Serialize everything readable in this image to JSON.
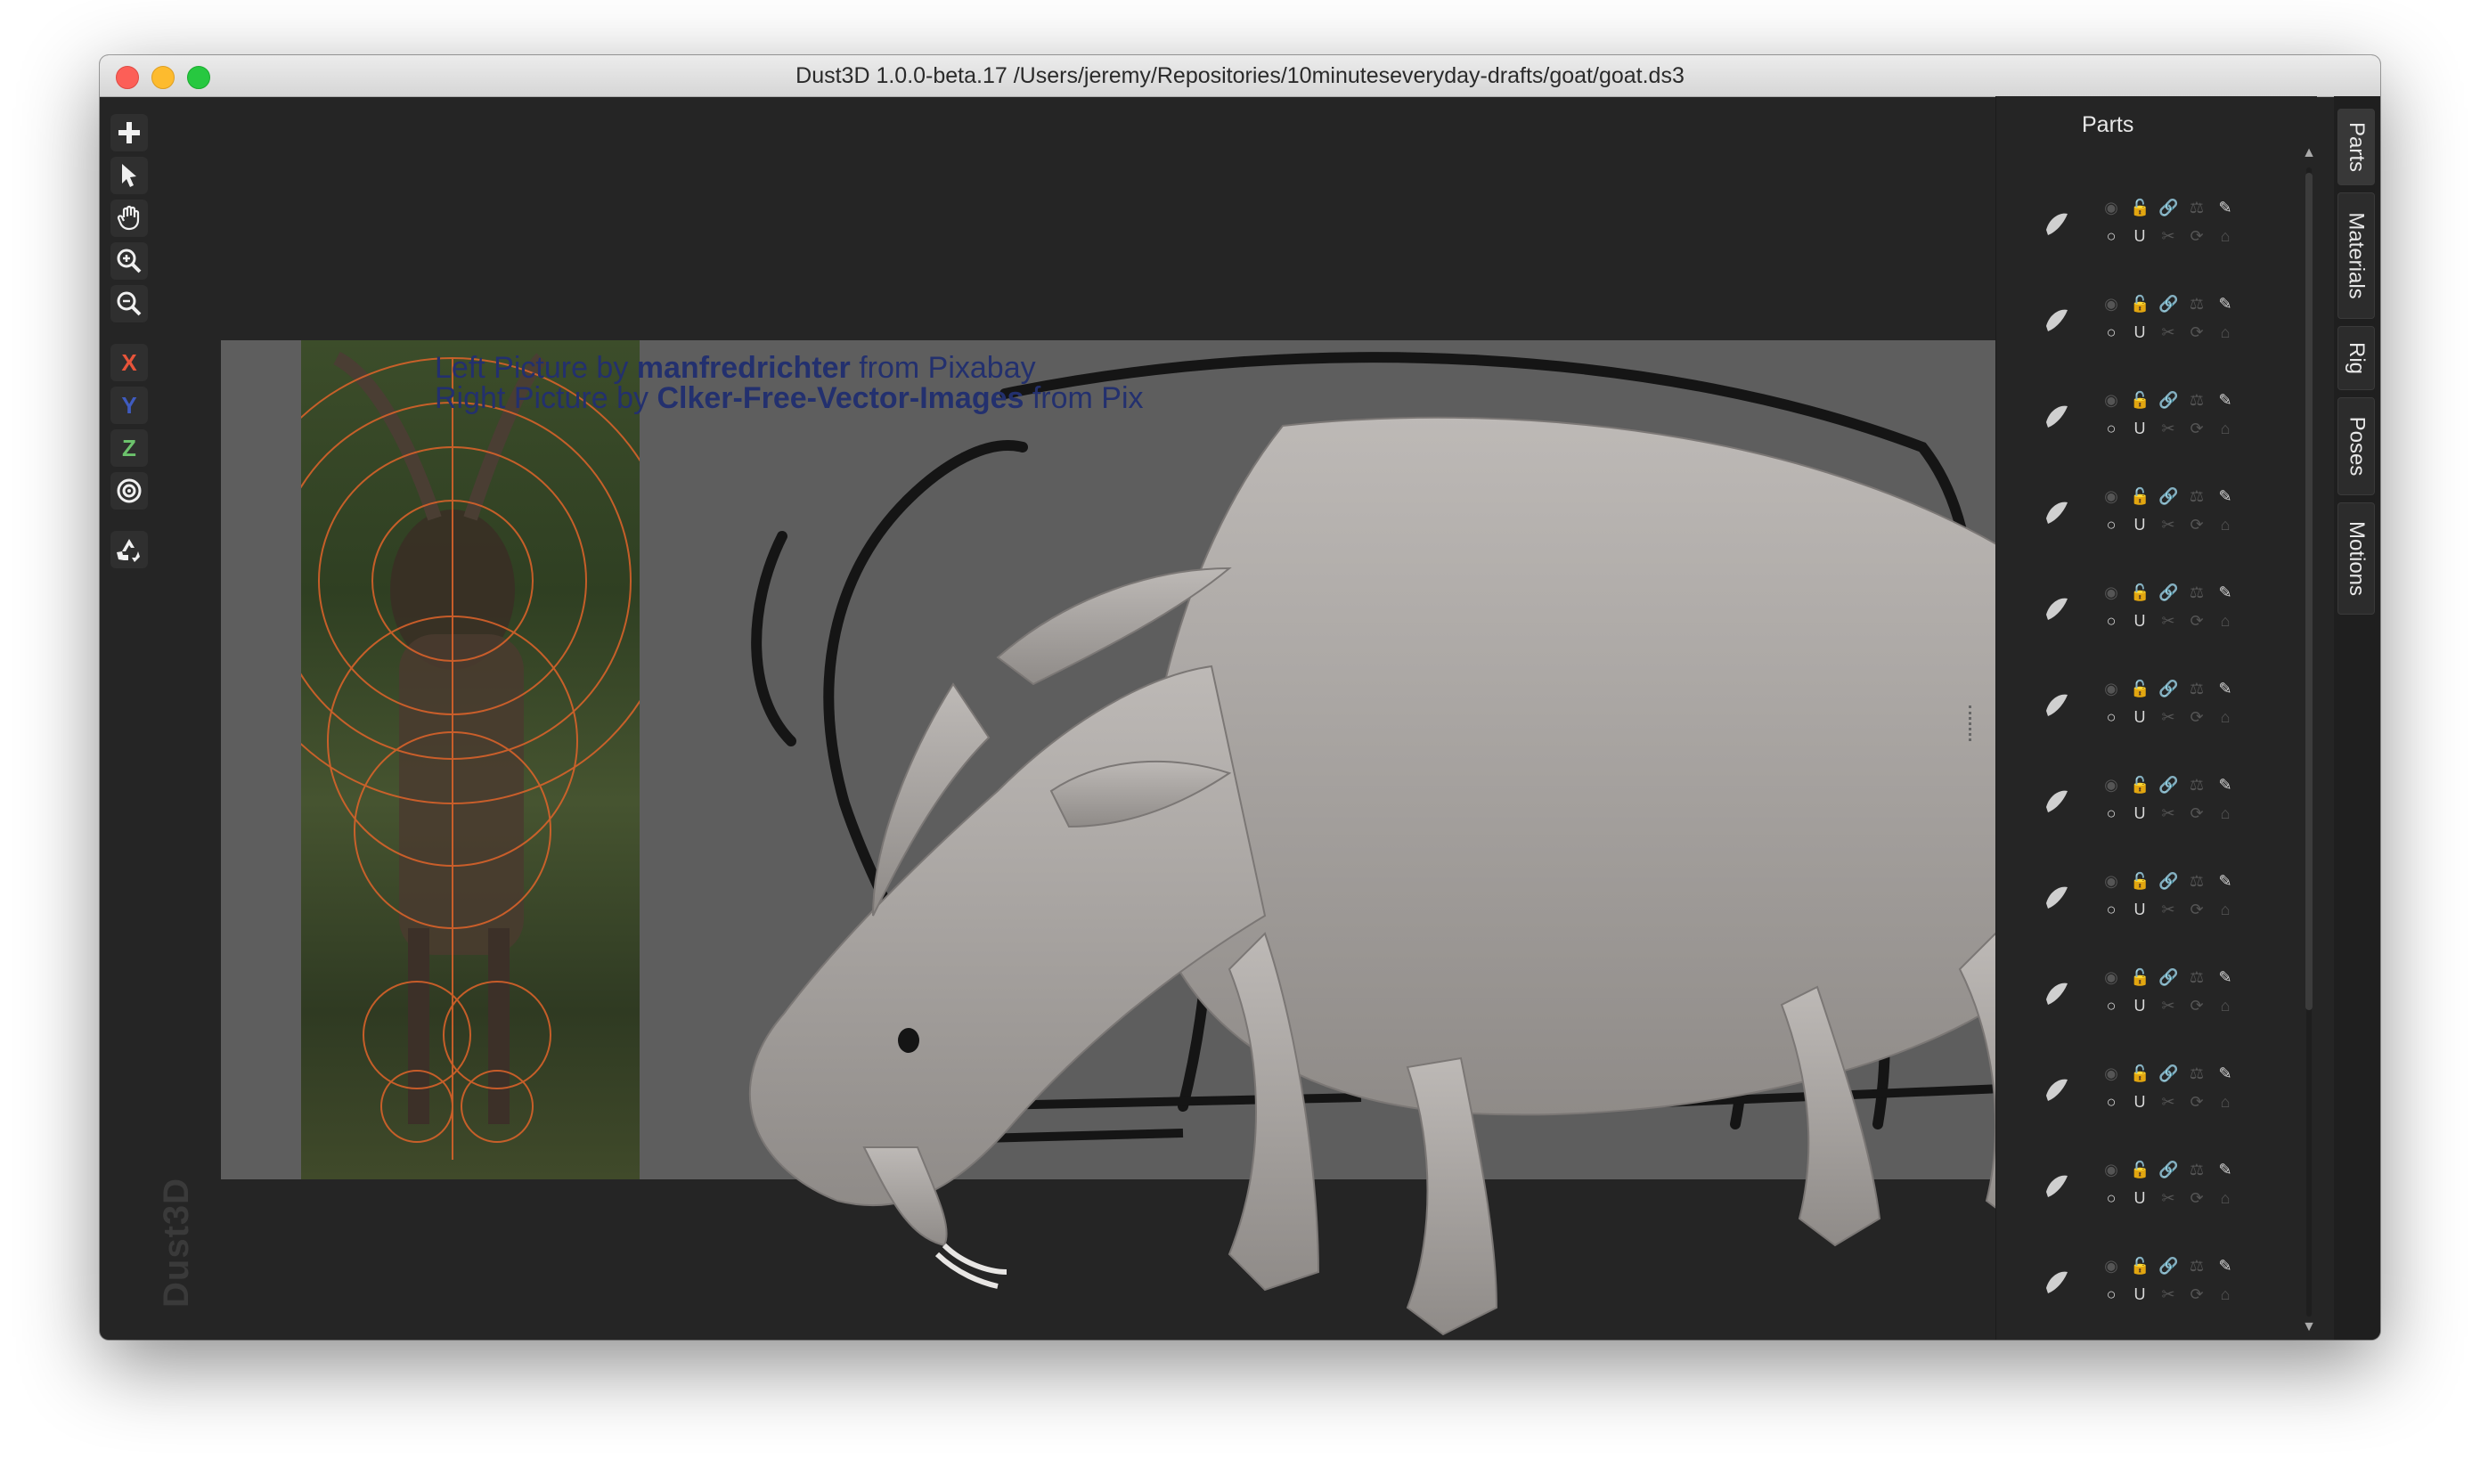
{
  "window": {
    "title": "Dust3D 1.0.0-beta.17 /Users/jeremy/Repositories/10minuteseveryday-drafts/goat/goat.ds3",
    "watermark": "Dust3D"
  },
  "toolbar": {
    "add_icon": "plus-icon",
    "select_icon": "cursor-icon",
    "pan_icon": "hand-icon",
    "zoom_in_icon": "zoom-in-icon",
    "zoom_out_icon": "zoom-out-icon",
    "x_label": "X",
    "y_label": "Y",
    "z_label": "Z",
    "radius_icon": "target-icon",
    "regenerate_icon": "recycle-icon",
    "colors": {
      "x": "#e8543a",
      "y": "#3f5bbf",
      "z": "#6cc26c"
    }
  },
  "reference": {
    "credit_line1_pre": "Left Picture by ",
    "credit_line1_author": "manfredrichter",
    "credit_line1_post": " from Pixabay",
    "credit_line2_pre": "Right Picture by ",
    "credit_line2_author": "Clker-Free-Vector-Images",
    "credit_line2_post": " from Pix"
  },
  "parts_panel": {
    "title": "Parts",
    "float_icon": "float-window-icon",
    "close_icon": "close-icon",
    "row_icons": [
      "visibility-icon",
      "lock-icon",
      "link-icon",
      "balance-icon",
      "paint-icon",
      "circle-icon",
      "magnet-icon",
      "scissors-icon",
      "rotate-icon",
      "chamfer-icon"
    ],
    "parts": [
      {
        "thumb": "part-horn-icon"
      },
      {
        "thumb": "part-body-icon"
      },
      {
        "thumb": "part-leg-icon"
      },
      {
        "thumb": "part-tail-icon"
      },
      {
        "thumb": "part-head-icon"
      },
      {
        "thumb": "part-horn-curve-icon"
      },
      {
        "thumb": "part-ear-icon"
      },
      {
        "thumb": "part-eye-icon"
      },
      {
        "thumb": "part-hoof-icon"
      },
      {
        "thumb": "part-hoof-icon"
      },
      {
        "thumb": "part-leg-icon"
      },
      {
        "thumb": "part-hoof-icon"
      }
    ]
  },
  "side_tabs": [
    "Parts",
    "Materials",
    "Rig",
    "Poses",
    "Motions"
  ]
}
